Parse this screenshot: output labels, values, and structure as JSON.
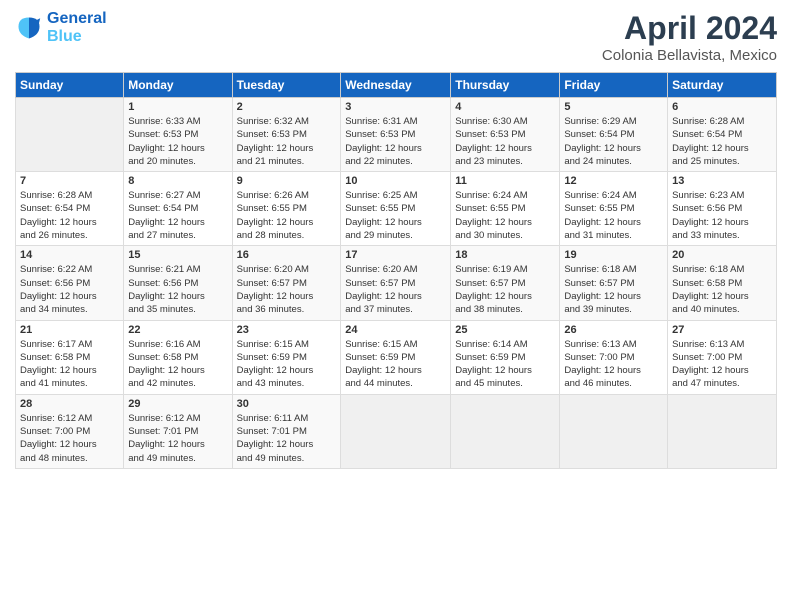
{
  "header": {
    "logo": {
      "line1": "General",
      "line2": "Blue"
    },
    "title": "April 2024",
    "subtitle": "Colonia Bellavista, Mexico"
  },
  "days_of_week": [
    "Sunday",
    "Monday",
    "Tuesday",
    "Wednesday",
    "Thursday",
    "Friday",
    "Saturday"
  ],
  "weeks": [
    [
      {
        "day": "",
        "info": ""
      },
      {
        "day": "1",
        "info": "Sunrise: 6:33 AM\nSunset: 6:53 PM\nDaylight: 12 hours\nand 20 minutes."
      },
      {
        "day": "2",
        "info": "Sunrise: 6:32 AM\nSunset: 6:53 PM\nDaylight: 12 hours\nand 21 minutes."
      },
      {
        "day": "3",
        "info": "Sunrise: 6:31 AM\nSunset: 6:53 PM\nDaylight: 12 hours\nand 22 minutes."
      },
      {
        "day": "4",
        "info": "Sunrise: 6:30 AM\nSunset: 6:53 PM\nDaylight: 12 hours\nand 23 minutes."
      },
      {
        "day": "5",
        "info": "Sunrise: 6:29 AM\nSunset: 6:54 PM\nDaylight: 12 hours\nand 24 minutes."
      },
      {
        "day": "6",
        "info": "Sunrise: 6:28 AM\nSunset: 6:54 PM\nDaylight: 12 hours\nand 25 minutes."
      }
    ],
    [
      {
        "day": "7",
        "info": "Sunrise: 6:28 AM\nSunset: 6:54 PM\nDaylight: 12 hours\nand 26 minutes."
      },
      {
        "day": "8",
        "info": "Sunrise: 6:27 AM\nSunset: 6:54 PM\nDaylight: 12 hours\nand 27 minutes."
      },
      {
        "day": "9",
        "info": "Sunrise: 6:26 AM\nSunset: 6:55 PM\nDaylight: 12 hours\nand 28 minutes."
      },
      {
        "day": "10",
        "info": "Sunrise: 6:25 AM\nSunset: 6:55 PM\nDaylight: 12 hours\nand 29 minutes."
      },
      {
        "day": "11",
        "info": "Sunrise: 6:24 AM\nSunset: 6:55 PM\nDaylight: 12 hours\nand 30 minutes."
      },
      {
        "day": "12",
        "info": "Sunrise: 6:24 AM\nSunset: 6:55 PM\nDaylight: 12 hours\nand 31 minutes."
      },
      {
        "day": "13",
        "info": "Sunrise: 6:23 AM\nSunset: 6:56 PM\nDaylight: 12 hours\nand 33 minutes."
      }
    ],
    [
      {
        "day": "14",
        "info": "Sunrise: 6:22 AM\nSunset: 6:56 PM\nDaylight: 12 hours\nand 34 minutes."
      },
      {
        "day": "15",
        "info": "Sunrise: 6:21 AM\nSunset: 6:56 PM\nDaylight: 12 hours\nand 35 minutes."
      },
      {
        "day": "16",
        "info": "Sunrise: 6:20 AM\nSunset: 6:57 PM\nDaylight: 12 hours\nand 36 minutes."
      },
      {
        "day": "17",
        "info": "Sunrise: 6:20 AM\nSunset: 6:57 PM\nDaylight: 12 hours\nand 37 minutes."
      },
      {
        "day": "18",
        "info": "Sunrise: 6:19 AM\nSunset: 6:57 PM\nDaylight: 12 hours\nand 38 minutes."
      },
      {
        "day": "19",
        "info": "Sunrise: 6:18 AM\nSunset: 6:57 PM\nDaylight: 12 hours\nand 39 minutes."
      },
      {
        "day": "20",
        "info": "Sunrise: 6:18 AM\nSunset: 6:58 PM\nDaylight: 12 hours\nand 40 minutes."
      }
    ],
    [
      {
        "day": "21",
        "info": "Sunrise: 6:17 AM\nSunset: 6:58 PM\nDaylight: 12 hours\nand 41 minutes."
      },
      {
        "day": "22",
        "info": "Sunrise: 6:16 AM\nSunset: 6:58 PM\nDaylight: 12 hours\nand 42 minutes."
      },
      {
        "day": "23",
        "info": "Sunrise: 6:15 AM\nSunset: 6:59 PM\nDaylight: 12 hours\nand 43 minutes."
      },
      {
        "day": "24",
        "info": "Sunrise: 6:15 AM\nSunset: 6:59 PM\nDaylight: 12 hours\nand 44 minutes."
      },
      {
        "day": "25",
        "info": "Sunrise: 6:14 AM\nSunset: 6:59 PM\nDaylight: 12 hours\nand 45 minutes."
      },
      {
        "day": "26",
        "info": "Sunrise: 6:13 AM\nSunset: 7:00 PM\nDaylight: 12 hours\nand 46 minutes."
      },
      {
        "day": "27",
        "info": "Sunrise: 6:13 AM\nSunset: 7:00 PM\nDaylight: 12 hours\nand 47 minutes."
      }
    ],
    [
      {
        "day": "28",
        "info": "Sunrise: 6:12 AM\nSunset: 7:00 PM\nDaylight: 12 hours\nand 48 minutes."
      },
      {
        "day": "29",
        "info": "Sunrise: 6:12 AM\nSunset: 7:01 PM\nDaylight: 12 hours\nand 49 minutes."
      },
      {
        "day": "30",
        "info": "Sunrise: 6:11 AM\nSunset: 7:01 PM\nDaylight: 12 hours\nand 49 minutes."
      },
      {
        "day": "",
        "info": ""
      },
      {
        "day": "",
        "info": ""
      },
      {
        "day": "",
        "info": ""
      },
      {
        "day": "",
        "info": ""
      }
    ]
  ]
}
